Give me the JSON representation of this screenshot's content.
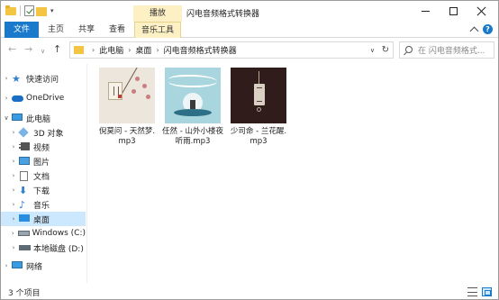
{
  "window": {
    "title": "闪电音频格式转换器",
    "context_tab_header": "播放"
  },
  "ribbon": {
    "tabs": [
      "文件",
      "主页",
      "共享",
      "查看",
      "音乐工具"
    ]
  },
  "address": {
    "segments": [
      "此电脑",
      "桌面",
      "闪电音频格式转换器"
    ],
    "separator": "›",
    "search_placeholder": "在 闪电音频格式..."
  },
  "nav_buttons": {
    "back": "←",
    "forward": "→",
    "recent": "∨",
    "up": "↑",
    "refresh": "↻",
    "address_dropdown": "∨"
  },
  "navpane": {
    "items": [
      {
        "label": "快速访问",
        "icon": "star-icon",
        "arrow": "›"
      },
      {
        "label": "OneDrive",
        "icon": "cloud-icon",
        "arrow": "›"
      },
      {
        "label": "此电脑",
        "icon": "computer-icon",
        "arrow": "∨"
      },
      {
        "label": "3D 对象",
        "icon": "3d-objects-icon",
        "arrow": "›"
      },
      {
        "label": "视频",
        "icon": "video-icon",
        "arrow": "›"
      },
      {
        "label": "图片",
        "icon": "pictures-icon",
        "arrow": "›"
      },
      {
        "label": "文档",
        "icon": "documents-icon",
        "arrow": "›"
      },
      {
        "label": "下载",
        "icon": "download-icon",
        "arrow": "›"
      },
      {
        "label": "音乐",
        "icon": "music-icon",
        "arrow": "›"
      },
      {
        "label": "桌面",
        "icon": "desktop-icon",
        "arrow": "›",
        "selected": true
      },
      {
        "label": "Windows (C:)",
        "icon": "drive-icon",
        "arrow": "›"
      },
      {
        "label": "本地磁盘 (D:)",
        "icon": "drive-icon",
        "arrow": "›"
      },
      {
        "label": "网络",
        "icon": "network-icon",
        "arrow": "›"
      }
    ]
  },
  "files": [
    {
      "name": "倪莫问 - 天然梦.mp3",
      "icon": "album-art-icon"
    },
    {
      "name": "任然 - 山外小楼夜听雨.mp3",
      "icon": "album-art-icon"
    },
    {
      "name": "少司命 - 兰花醒.mp3",
      "icon": "album-art-icon"
    }
  ],
  "status": {
    "item_count": "3 个项目"
  },
  "colors": {
    "accent": "#1979ca",
    "selection": "#cce8ff",
    "context_tab": "#fcf0c4",
    "folder": "#f4c542"
  }
}
